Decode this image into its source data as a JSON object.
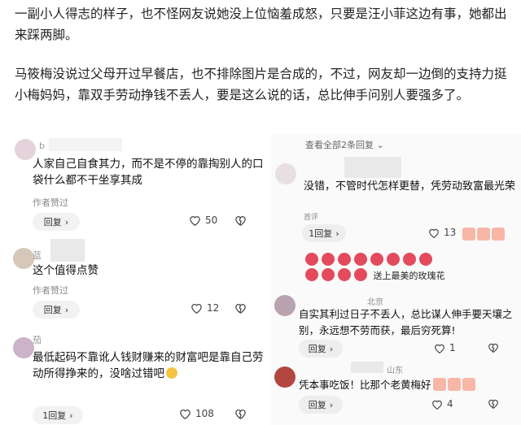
{
  "article": {
    "p1": "一副小人得志的样子，也不怪网友说她没上位恼羞成怒，只要是汪小菲这边有事，她都出来踩两脚。",
    "p2": "马筱梅没说过父母开过早餐店，也不排除图片是合成的，不过，网友却一边倒的支持力挺小梅妈妈，靠双手劳动挣钱不丢人，要是这么说的话，总比伸手问别人要强多了。"
  },
  "left_panel": {
    "comments": [
      {
        "user": "b",
        "text": "人家自己自食其力，而不是不停的靠掏别人的口袋什么都不干坐享其成",
        "liked_by_author": "作者赞过",
        "reply_label": "回复",
        "like_count": "50"
      },
      {
        "user": "蓝",
        "text": "这个值得点赞",
        "liked_by_author": "作者赞过",
        "reply_label": "回复",
        "like_count": "12"
      },
      {
        "user": "茄",
        "text": "最低起码不靠讹人钱财赚来的财富吧是靠自己劳动所得挣来的，没啥过错吧",
        "reply_label": "1回复",
        "like_count": "108"
      }
    ]
  },
  "right_panel": {
    "header": "查看全部2条回复",
    "comments": [
      {
        "text": "没错，不管时代怎样更替，凭劳动致富最光荣",
        "region": "首评",
        "reply_label": "1回复",
        "like_count": "13",
        "gift_text": "送上最美的玫瑰花"
      },
      {
        "location": "北京",
        "text": "自实其利过日子不丢人，总比谋人伸手要天壤之别，永远想不劳而获，最后穷死算!",
        "reply_label": "回复",
        "like_count": "1"
      },
      {
        "location": "山东",
        "text": "凭本事吃饭！比那个老黄梅好",
        "reply_label": "回复",
        "like_count": "4"
      }
    ]
  },
  "colors": {
    "text": "#222222",
    "muted": "#999999",
    "reply_bg": "#f2f2f2",
    "rose": "#e34b5d"
  }
}
